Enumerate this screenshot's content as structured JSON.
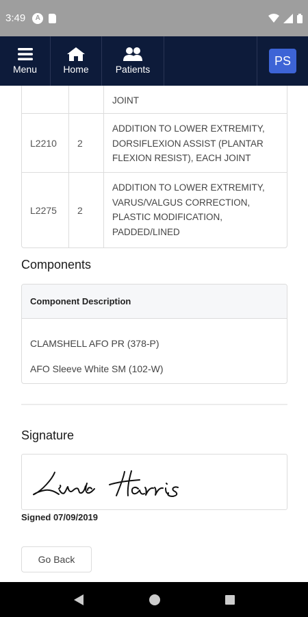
{
  "status_bar": {
    "time": "3:49",
    "a_icon_letter": "A"
  },
  "navbar": {
    "menu_label": "Menu",
    "home_label": "Home",
    "patients_label": "Patients",
    "avatar_initials": "PS"
  },
  "codes": [
    {
      "code": "",
      "qty": "",
      "description": "JOINT"
    },
    {
      "code": "L2210",
      "qty": "2",
      "description": "ADDITION TO LOWER EXTREMITY, DORSIFLEXION ASSIST (PLANTAR FLEXION RESIST), EACH JOINT"
    },
    {
      "code": "L2275",
      "qty": "2",
      "description": "ADDITION TO LOWER EXTREMITY, VARUS/VALGUS CORRECTION, PLASTIC MODIFICATION, PADDED/LINED"
    }
  ],
  "components": {
    "title": "Components",
    "header": "Component Description",
    "items": [
      "CLAMSHELL AFO PR (378-P)",
      "AFO Sleeve White SM (102-W)"
    ]
  },
  "signature": {
    "title": "Signature",
    "signed_text": "Signed 07/09/2019"
  },
  "actions": {
    "go_back_label": "Go Back"
  },
  "colors": {
    "navbar_bg": "#0d1b3a",
    "avatar_bg": "#3d64d6",
    "status_bar_bg": "#9e9e9e"
  }
}
